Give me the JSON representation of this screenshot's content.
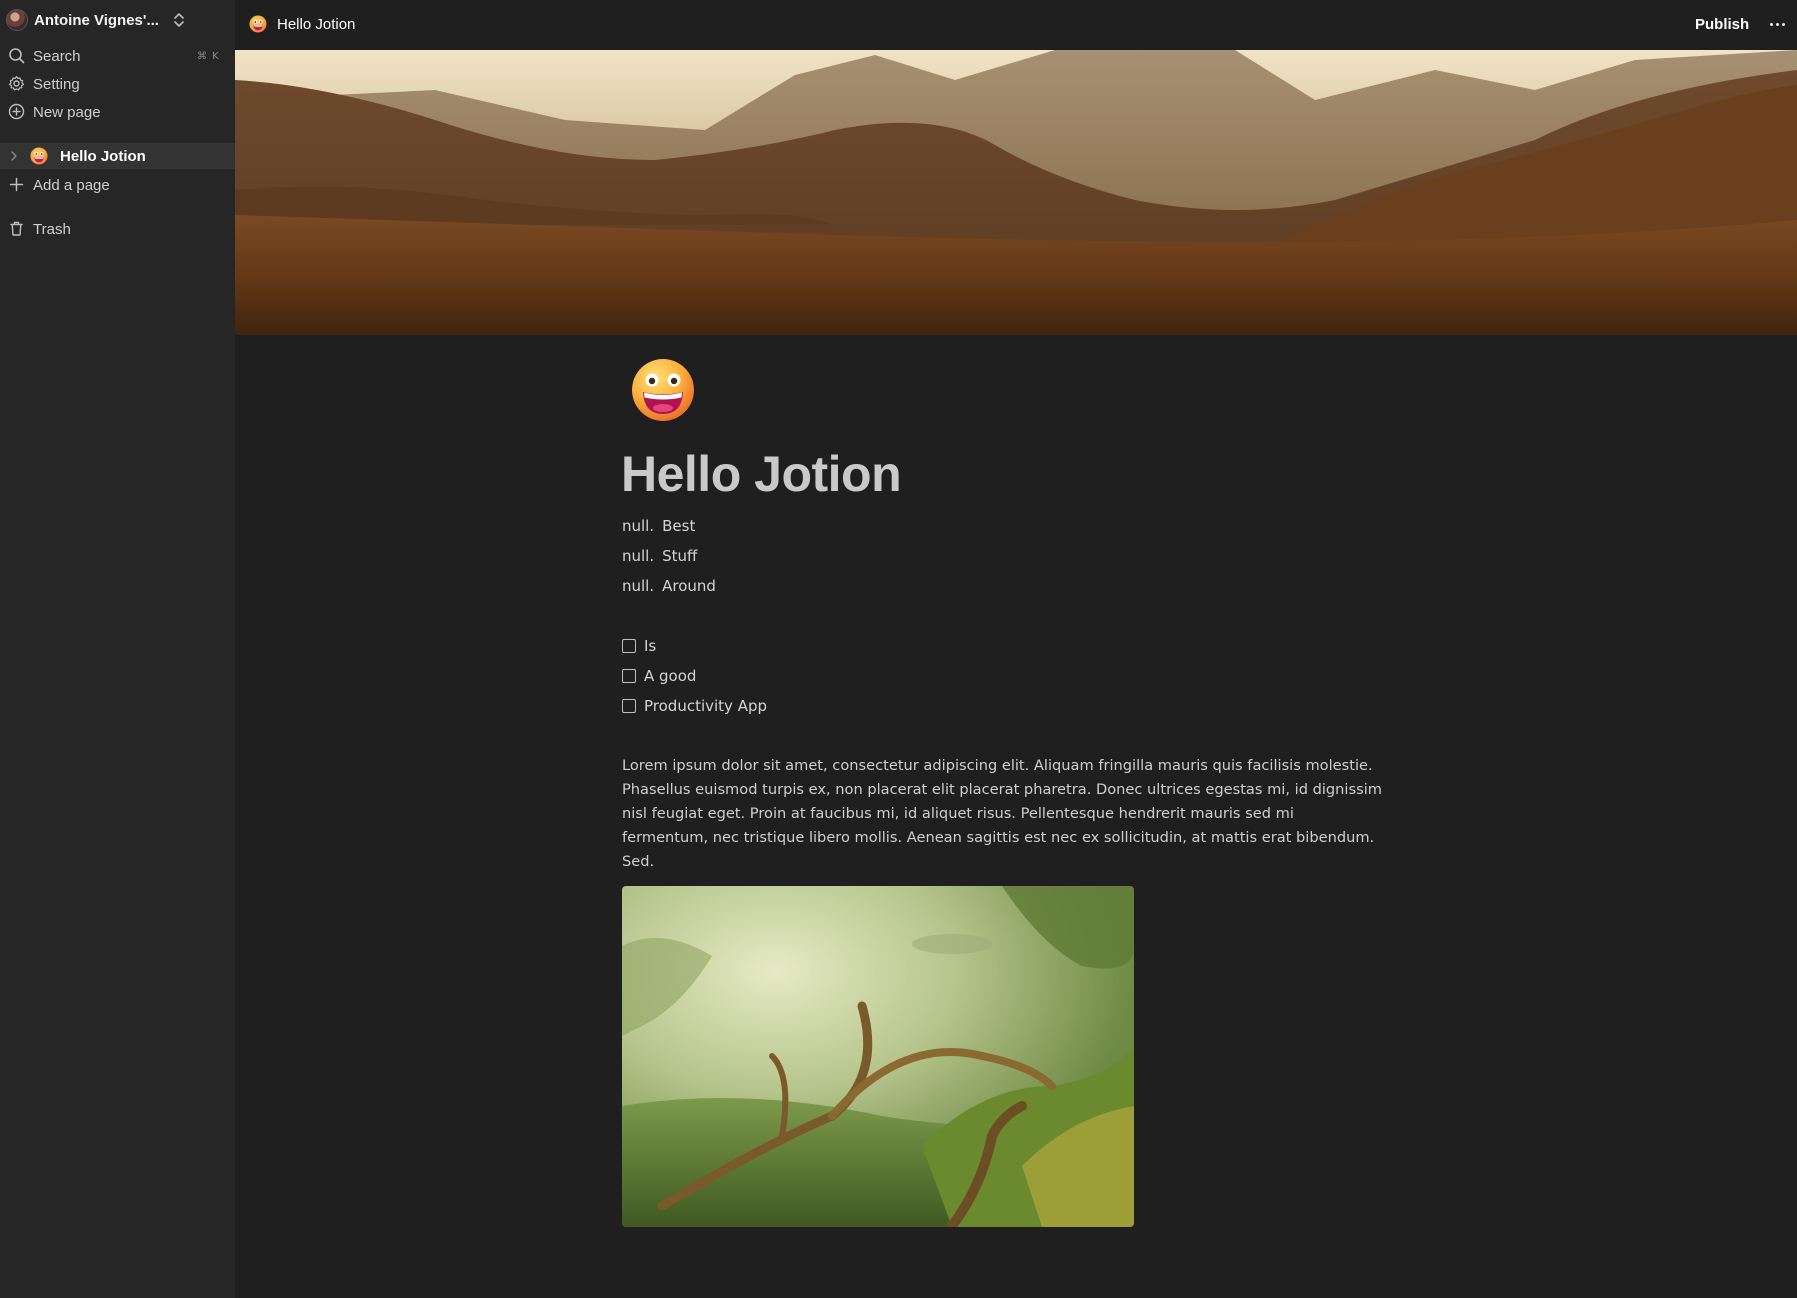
{
  "workspace": {
    "name": "Antoine Vignes'...",
    "avatar_icon": "user-avatar",
    "switch_icon": "chevron-up-down-icon"
  },
  "sidebar": {
    "search_label": "Search",
    "search_shortcut": "⌘ K",
    "setting_label": "Setting",
    "new_page_label": "New page",
    "pages": [
      {
        "label": "Hello Jotion",
        "emoji": "grinning-face-emoji",
        "active": true
      }
    ],
    "add_page_label": "Add a page",
    "trash_label": "Trash"
  },
  "topbar": {
    "page_title": "Hello Jotion",
    "publish_label": "Publish",
    "more_icon": "more-horizontal-icon"
  },
  "document": {
    "icon": "grinning-face-emoji",
    "title": "Hello Jotion",
    "numbered_list": [
      {
        "number": "null.",
        "text": "Best"
      },
      {
        "number": "null.",
        "text": "Stuff"
      },
      {
        "number": "null.",
        "text": "Around"
      }
    ],
    "checklist": [
      {
        "text": "Is",
        "checked": false
      },
      {
        "text": "A good",
        "checked": false
      },
      {
        "text": "Productivity App",
        "checked": false
      }
    ],
    "paragraph": "Lorem ipsum dolor sit amet, consectetur adipiscing elit. Aliquam fringilla mauris quis facilisis molestie. Phasellus euismod turpis ex, non placerat elit placerat pharetra. Donec ultrices egestas mi, id dignissim nisl feugiat eget. Proin at faucibus mi, id aliquet risus. Pellentesque hendrerit mauris sed mi fermentum, nec tristique libero mollis. Aenean sagittis est nec ex sollicitudin, at mattis erat bibendum. Sed.",
    "cover_image": "mountain-landscape-cover",
    "inline_image": "mossy-forest-photo"
  },
  "colors": {
    "sidebar_bg": "#262626",
    "main_bg": "#1f1f1f",
    "active_item_bg": "#333333"
  }
}
